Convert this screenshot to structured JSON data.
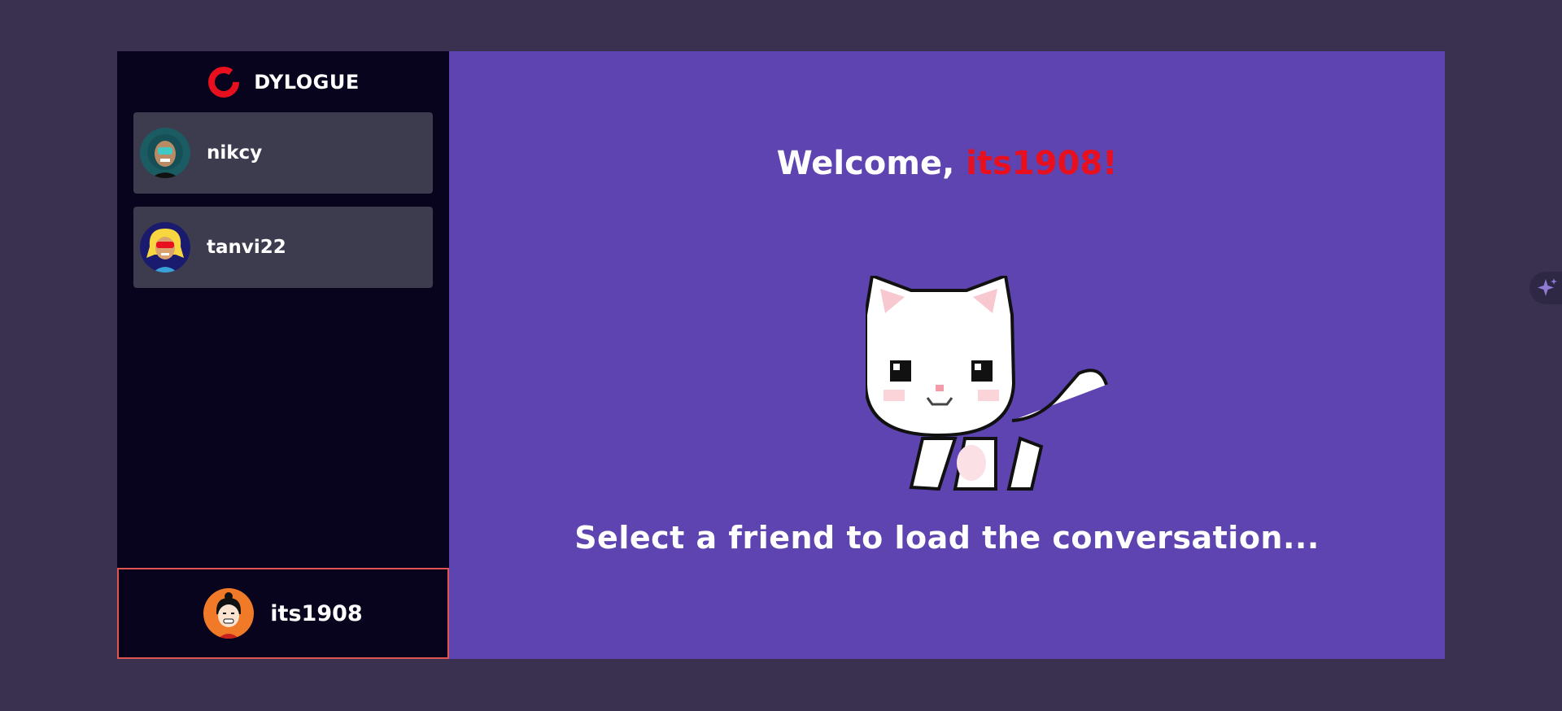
{
  "brand": {
    "name": "DYLOGUE",
    "accent": "#e8101e"
  },
  "contacts": [
    {
      "label": "nikcy"
    },
    {
      "label": "tanvi22"
    }
  ],
  "current_user": {
    "label": "its1908"
  },
  "main": {
    "welcome_prefix": "Welcome, ",
    "welcome_user": "its1908!",
    "prompt": "Select a friend to load the conversation..."
  },
  "icons": {
    "logo": "ring-logo-icon",
    "mascot": "pixel-cat-image",
    "assistant": "sparkle-icon"
  },
  "colors": {
    "page_bg": "#3a3050",
    "sidebar_bg": "#08041e",
    "contact_bg": "#3d3b4e",
    "main_bg": "#5e44b0",
    "highlight": "#e8101e",
    "me_border": "#e05452"
  }
}
